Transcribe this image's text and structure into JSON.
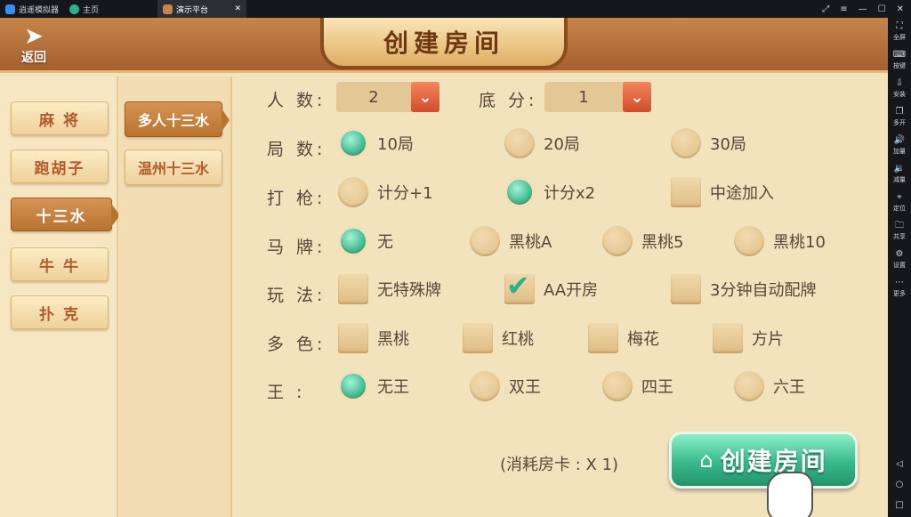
{
  "emulator": {
    "tabs": [
      {
        "label": "逍遥模拟器",
        "icon": "emulator-logo-icon"
      },
      {
        "label": "主页",
        "icon": "home-icon"
      },
      {
        "label": "演示平台",
        "icon": "app-icon"
      }
    ],
    "window_controls": [
      "⤢",
      "≡",
      "—",
      "☐",
      "✕"
    ],
    "sidebar": [
      {
        "label": "全屏",
        "icon": "⛶"
      },
      {
        "label": "按键",
        "icon": "⌨"
      },
      {
        "label": "安装",
        "icon": "⇩"
      },
      {
        "label": "多开",
        "icon": "❐"
      },
      {
        "label": "加量",
        "icon": "🔊"
      },
      {
        "label": "减量",
        "icon": "🔉"
      },
      {
        "label": "定位",
        "icon": "⌖"
      },
      {
        "label": "共享",
        "icon": "🗀"
      },
      {
        "label": "设置",
        "icon": "⚙"
      },
      {
        "label": "更多",
        "icon": "⋯"
      }
    ],
    "nav": [
      "◁",
      "○",
      "□"
    ]
  },
  "header": {
    "back_label": "返回",
    "title": "创建房间"
  },
  "categories": [
    "麻 将",
    "跑胡子",
    "十三水",
    "牛 牛",
    "扑 克"
  ],
  "selected_category": "十三水",
  "subcategories": [
    "多人十三水",
    "温州十三水"
  ],
  "selected_subcategory": "多人十三水",
  "settings": {
    "players": {
      "label": "人 数:",
      "value": "2"
    },
    "base_score": {
      "label": "底 分:",
      "value": "1"
    },
    "rounds": {
      "label": "局 数:",
      "options": [
        "10局",
        "20局",
        "30局"
      ],
      "selected": "10局"
    },
    "shoot": {
      "label": "打 枪:",
      "options": [
        "计分+1",
        "计分x2",
        "中途加入"
      ],
      "selected": "计分x2"
    },
    "horse": {
      "label": "马 牌:",
      "options": [
        "无",
        "黑桃A",
        "黑桃5",
        "黑桃10"
      ],
      "selected": "无"
    },
    "play": {
      "label": "玩 法:",
      "options": [
        "无特殊牌",
        "AA开房",
        "3分钟自动配牌"
      ],
      "checked": [
        "AA开房"
      ]
    },
    "colors": {
      "label": "多 色:",
      "options": [
        "黑桃",
        "红桃",
        "梅花",
        "方片"
      ],
      "checked": []
    },
    "king": {
      "label": "王 :",
      "options": [
        "无王",
        "双王",
        "四王",
        "六王"
      ],
      "selected": "无王"
    }
  },
  "cost_text": "(消耗房卡 : X 1)",
  "create_label": "创建房间",
  "colors_theme": {
    "accent_green": "#3fbf93",
    "header_brown": "#a45f2e",
    "panel_cream": "#f3e3bd"
  }
}
